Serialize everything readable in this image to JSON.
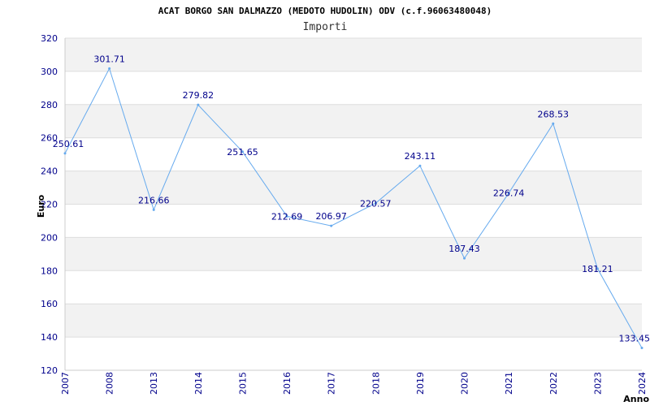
{
  "colors": {
    "line": "#66aaee",
    "band": "#f2f2f2",
    "grid": "#dddddd",
    "axis": "#cccccc",
    "tick_text": "#00008b"
  },
  "chart_data": {
    "type": "line",
    "title": "ACAT BORGO SAN DALMAZZO (MEDOTO HUDOLIN) ODV (c.f.96063480048)",
    "subtitle": "Importi",
    "xlabel": "Anno",
    "ylabel": "Euro",
    "ylim": [
      120,
      320
    ],
    "yticks": [
      120,
      140,
      160,
      180,
      200,
      220,
      240,
      260,
      280,
      300,
      320
    ],
    "grid": true,
    "categories": [
      "2007",
      "2008",
      "2013",
      "2014",
      "2015",
      "2016",
      "2017",
      "2018",
      "2019",
      "2020",
      "2021",
      "2022",
      "2023",
      "2024"
    ],
    "values": [
      250.61,
      301.71,
      216.66,
      279.82,
      251.65,
      212.69,
      206.97,
      220.57,
      243.11,
      187.43,
      226.74,
      268.53,
      181.21,
      133.45
    ],
    "value_labels": [
      "250.61",
      "301.71",
      "216.66",
      "279.82",
      "251.65",
      "212.69",
      "206.97",
      "220.57",
      "243.11",
      "187.43",
      "226.74",
      "268.53",
      "181.21",
      "133.45"
    ]
  }
}
